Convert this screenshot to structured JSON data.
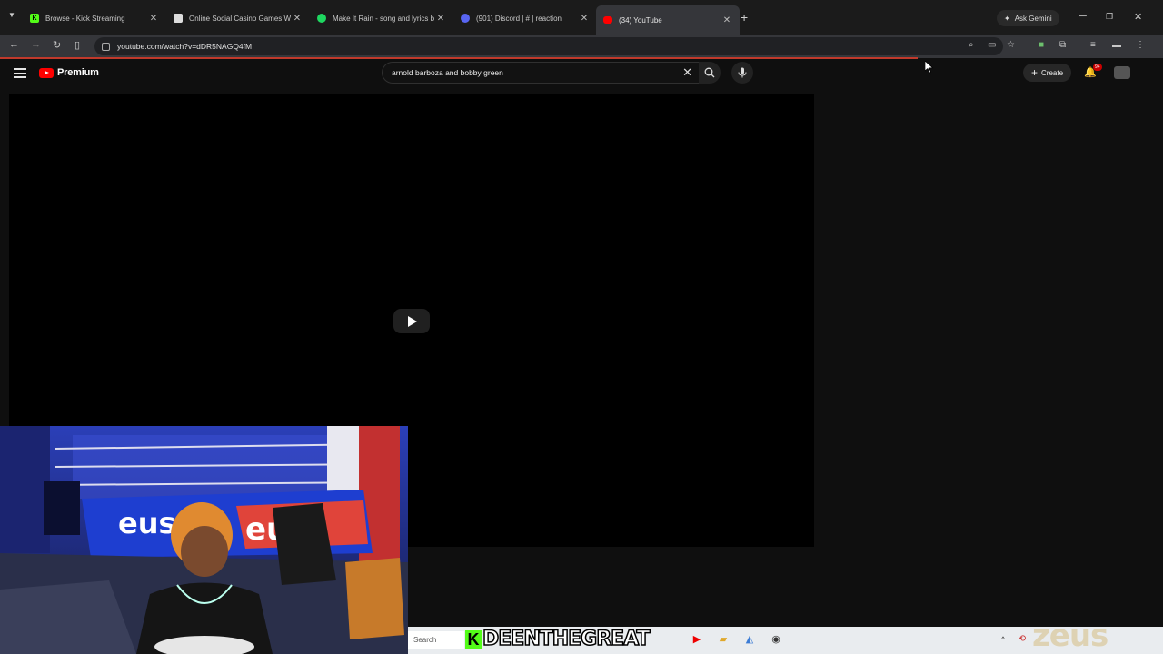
{
  "browser": {
    "tabs": [
      {
        "title": "Browse - Kick Streaming",
        "favicon": "kick-icon",
        "active": false
      },
      {
        "title": "Online Social Casino Games W",
        "favicon": "casino-icon",
        "active": false
      },
      {
        "title": "Make It Rain - song and lyrics b",
        "favicon": "spotify-icon",
        "active": false
      },
      {
        "title": "(901) Discord | # | reaction",
        "favicon": "discord-icon",
        "active": false
      },
      {
        "title": "(34) YouTube",
        "favicon": "youtube-icon",
        "active": true
      }
    ],
    "gemini_label": "Ask Gemini",
    "url": "youtube.com/watch?v=dDR5NAGQ4fM"
  },
  "youtube": {
    "logo_text": "Premium",
    "search_query": "arnold barboza and bobby green",
    "create_label": "Create",
    "notification_badge": "9+"
  },
  "overlay": {
    "streamer_name": "DEENTHEGREAT",
    "streamer_prefix": "K",
    "watermark": "zeus"
  },
  "taskbar": {
    "search_placeholder": "Search"
  },
  "colors": {
    "youtube_red": "#ff0000",
    "kick_green": "#53fc18",
    "loading_bar": "#c0392b"
  }
}
